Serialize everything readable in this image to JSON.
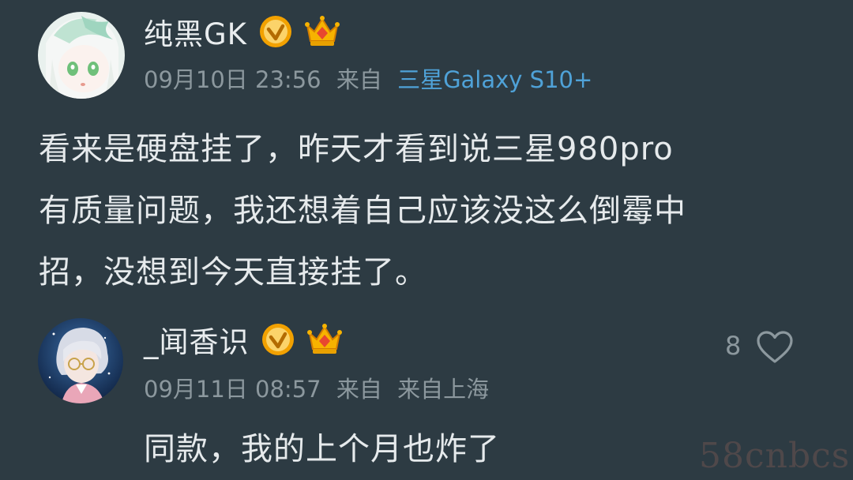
{
  "post": {
    "username": "纯黑GK",
    "date": "09月10日 23:56",
    "from_label": "来自",
    "device": "三星Galaxy S10+",
    "body_lines": [
      "看来是硬盘挂了，昨天才看到说三星980pro",
      "有质量问题，我还想着自己应该没这么倒霉中",
      "招，没想到今天直接挂了。"
    ]
  },
  "reply": {
    "username": "_闻香识",
    "date": "09月11日 08:57",
    "from_label": "来自",
    "location": "来自上海",
    "like_count": "8",
    "body": "同款，我的上个月也炸了"
  },
  "watermark": "58cnbcs",
  "icons": {
    "verified": "verified-badge-icon",
    "crown": "crown-icon",
    "like": "heart-outline-icon"
  },
  "colors": {
    "background": "#2d3b43",
    "link": "#4fa2d8",
    "verified": "#f2a100",
    "secondary_text": "#8c989e"
  }
}
